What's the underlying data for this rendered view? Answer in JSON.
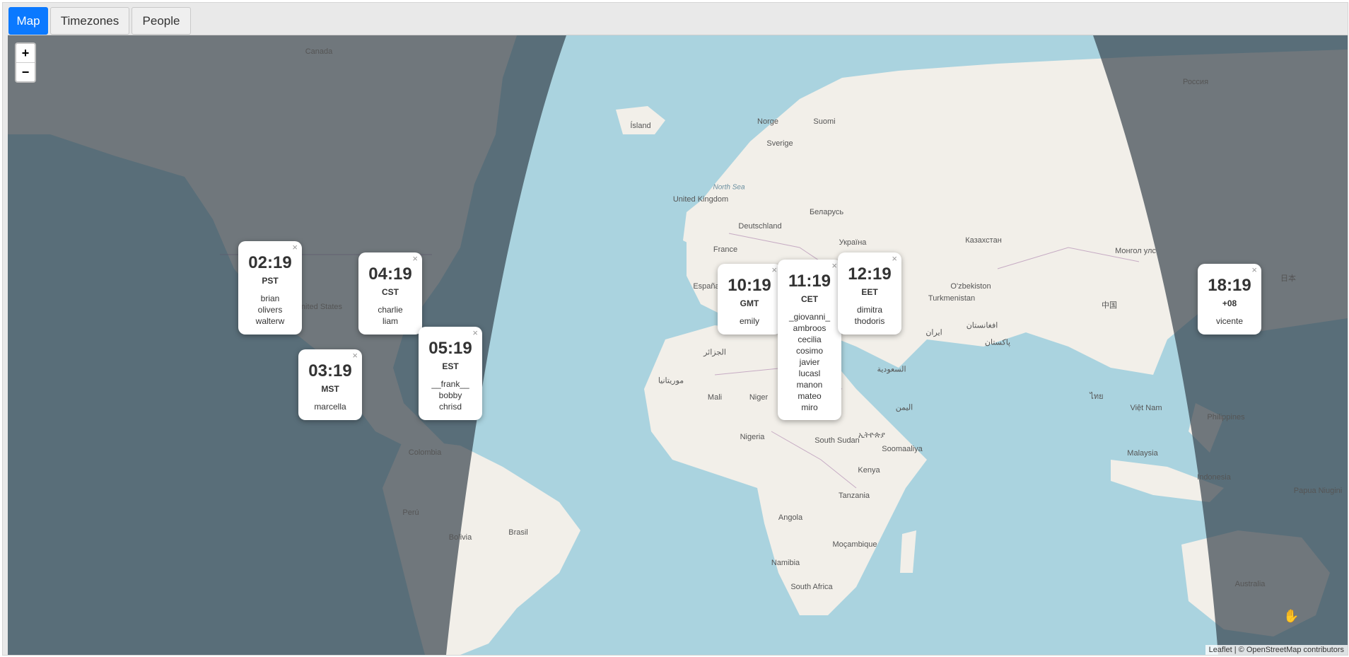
{
  "tabs": [
    {
      "label": "Map",
      "active": true
    },
    {
      "label": "Timezones",
      "active": false
    },
    {
      "label": "People",
      "active": false
    }
  ],
  "zoom": {
    "in": "+",
    "out": "−"
  },
  "attribution": "Leaflet | © OpenStreetMap contributors",
  "popups": [
    {
      "time": "02:19",
      "zone": "PST",
      "people": [
        "brian",
        "olivers",
        "walterw"
      ]
    },
    {
      "time": "04:19",
      "zone": "CST",
      "people": [
        "charlie",
        "liam"
      ]
    },
    {
      "time": "03:19",
      "zone": "MST",
      "people": [
        "marcella"
      ]
    },
    {
      "time": "05:19",
      "zone": "EST",
      "people": [
        "__frank__",
        "bobby",
        "chrisd"
      ]
    },
    {
      "time": "10:19",
      "zone": "GMT",
      "people": [
        "emily"
      ]
    },
    {
      "time": "11:19",
      "zone": "CET",
      "people": [
        "_giovanni_",
        "ambroos",
        "cecilia",
        "cosimo",
        "javier",
        "lucasl",
        "manon",
        "mateo",
        "miro"
      ]
    },
    {
      "time": "12:19",
      "zone": "EET",
      "people": [
        "dimitra",
        "thodoris"
      ]
    },
    {
      "time": "18:19",
      "zone": "+08",
      "people": [
        "vicente"
      ]
    }
  ],
  "close_symbol": "×",
  "map_labels": [
    "Canada",
    "United States",
    "Colombia",
    "Perú",
    "Bolivia",
    "Brasil",
    "Ísland",
    "Norge",
    "Suomi",
    "Sverige",
    "United Kingdom",
    "North Sea",
    "Deutschland",
    "Беларусь",
    "Україна",
    "France",
    "España",
    "Казахстан",
    "Монгол улс",
    "Россия",
    "O'zbekiston",
    "Turkmenistan",
    "ایران",
    "افغانستان",
    "پاکستان",
    "中国",
    "日本",
    "الجزائر",
    "موريتانيا",
    "Mali",
    "Niger",
    "Nigeria",
    "South Sudan",
    "السعودية",
    "اليمن",
    "ኢትዮጵያ",
    "Soomaaliya",
    "Kenya",
    "Tanzania",
    "Angola",
    "Namibia",
    "Moçambique",
    "South Africa",
    "Việt Nam",
    "Philippines",
    "Malaysia",
    "Indonesia",
    "Papua Niugini",
    "Australia",
    "ไทย"
  ],
  "colors": {
    "ocean": "#aad3df",
    "land": "#f2efe9",
    "night": "rgba(50,60,70,0.55)",
    "accent": "#0b79ff"
  }
}
